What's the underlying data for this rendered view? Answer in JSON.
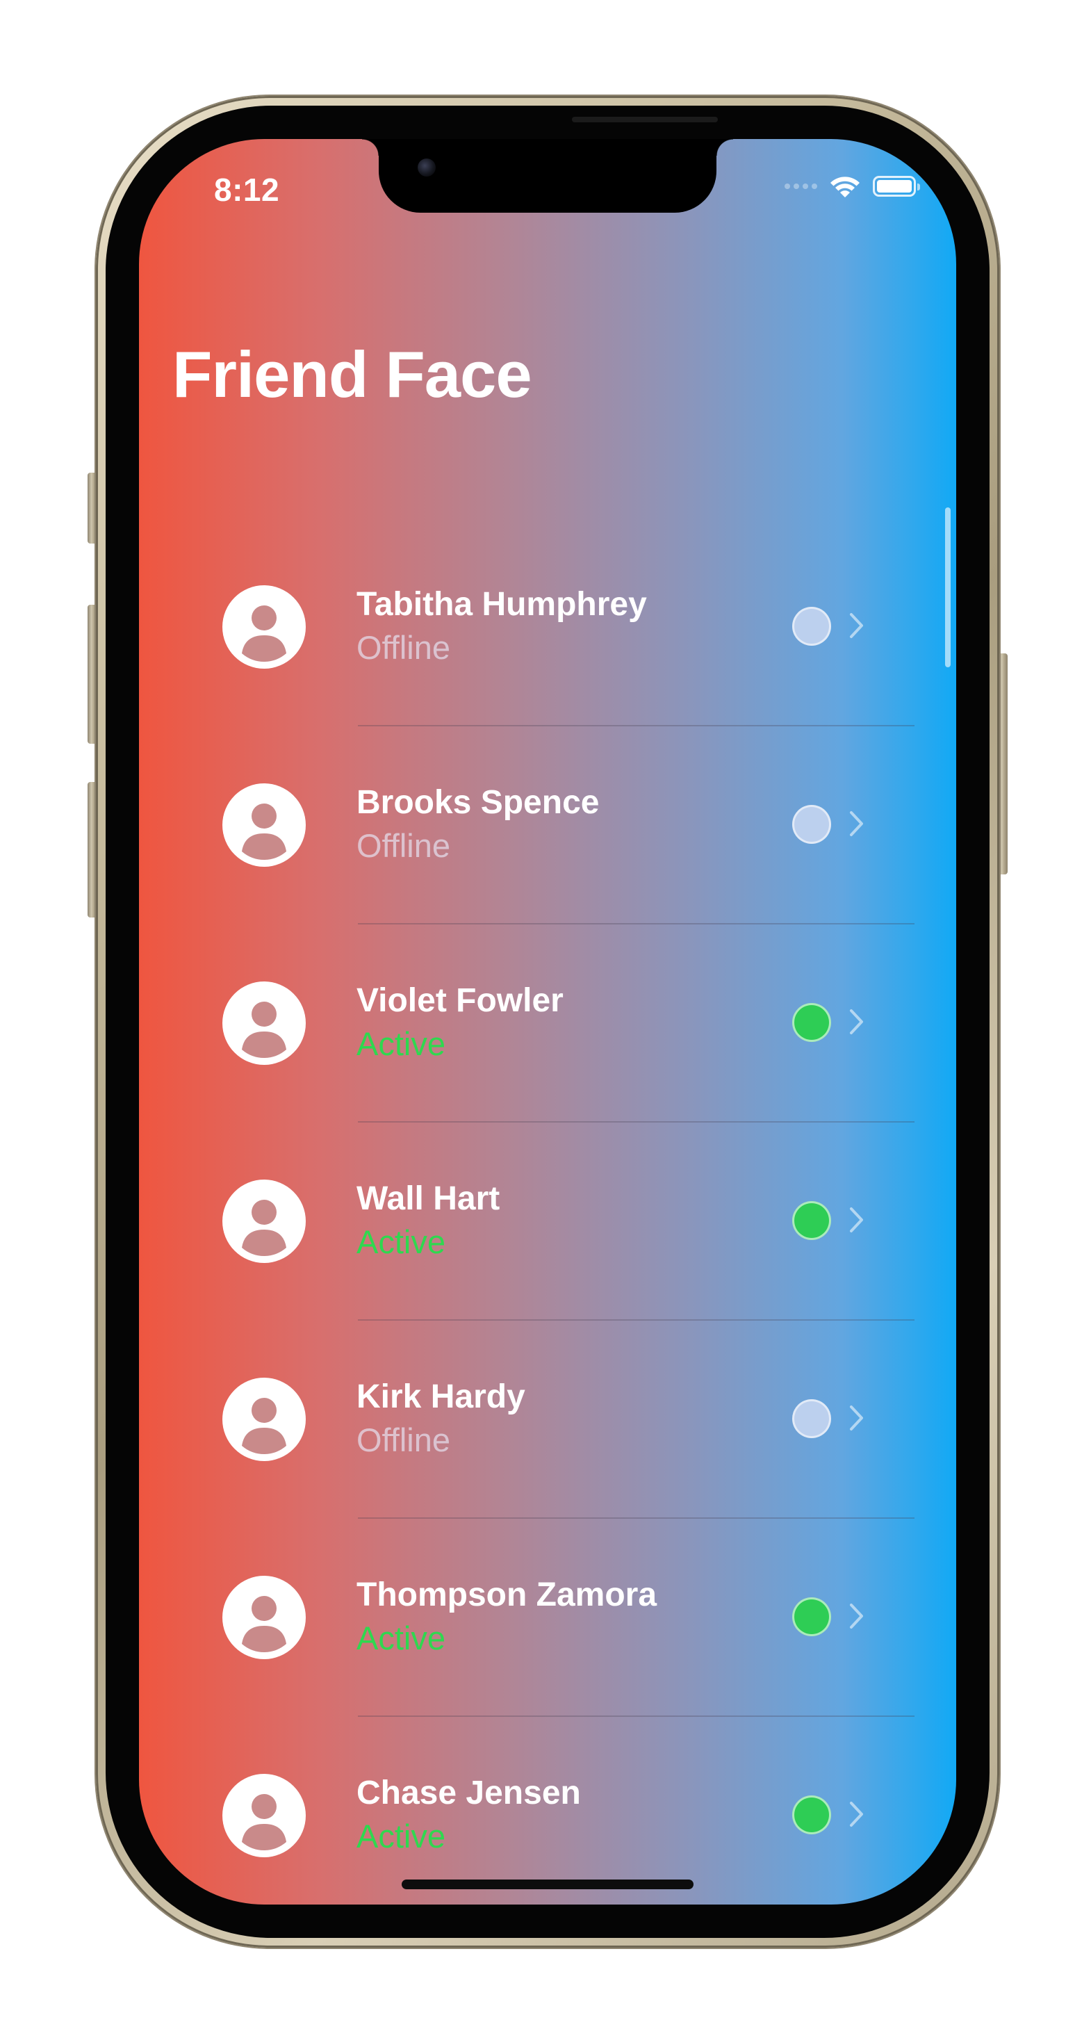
{
  "status_bar": {
    "time": "8:12",
    "wifi_icon": "wifi-icon",
    "battery_icon": "battery-icon"
  },
  "screen": {
    "title": "Friend Face",
    "gradient_colors": [
      "#ef5640",
      "#12a9f5"
    ]
  },
  "friends": [
    {
      "name": "Tabitha Humphrey",
      "status": "Offline",
      "active": false
    },
    {
      "name": "Brooks Spence",
      "status": "Offline",
      "active": false
    },
    {
      "name": "Violet Fowler",
      "status": "Active",
      "active": true
    },
    {
      "name": "Wall Hart",
      "status": "Active",
      "active": true
    },
    {
      "name": "Kirk Hardy",
      "status": "Offline",
      "active": false
    },
    {
      "name": "Thompson Zamora",
      "status": "Active",
      "active": true
    },
    {
      "name": "Chase Jensen",
      "status": "Active",
      "active": true
    }
  ],
  "colors": {
    "active_green": "#2ecd55",
    "offline_dot": "#bcd0ee"
  },
  "icons": {
    "avatar": "person-circle-icon",
    "disclosure": "chevron-right-icon"
  }
}
